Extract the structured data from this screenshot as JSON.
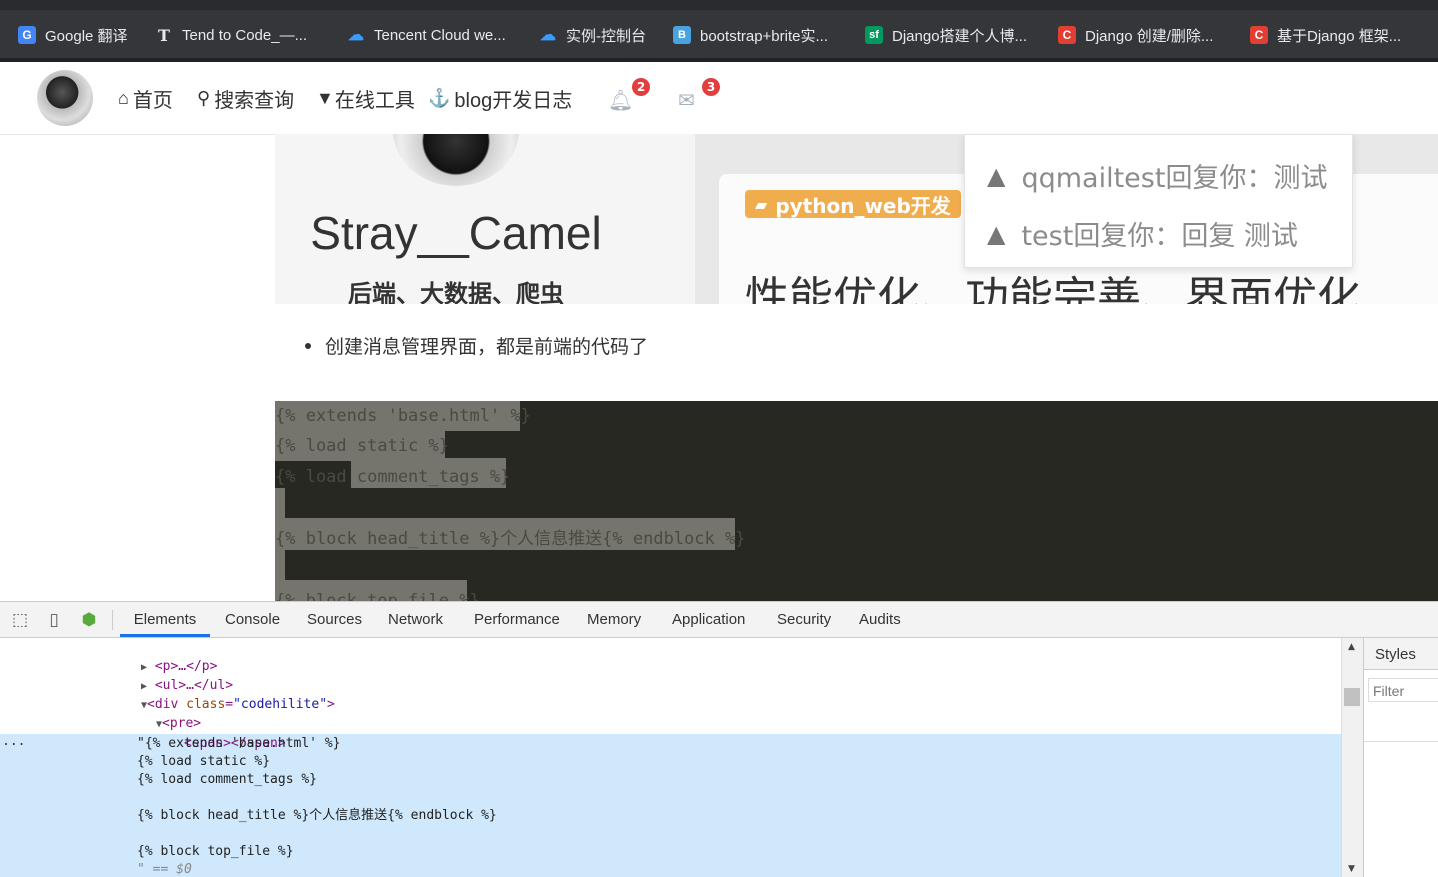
{
  "bookmarks": [
    {
      "label": "Google 翻译",
      "icon": "google-translate-icon"
    },
    {
      "label": "Tend to Code_—...",
      "icon": "t-icon"
    },
    {
      "label": "Tencent Cloud we...",
      "icon": "cloud-icon"
    },
    {
      "label": "实例-控制台",
      "icon": "cloud-icon"
    },
    {
      "label": "bootstrap+brite实...",
      "icon": "bootstrap-icon"
    },
    {
      "label": "Django搭建个人博...",
      "icon": "sf-icon"
    },
    {
      "label": "Django 创建/删除...",
      "icon": "csdn-icon"
    },
    {
      "label": "基于Django 框架...",
      "icon": "csdn-icon"
    }
  ],
  "nav": {
    "home": "首页",
    "search": "搜索查询",
    "tools": "在线工具",
    "devlog": "blog开发日志",
    "bell_count": "2",
    "mail_count": "3"
  },
  "profile": {
    "name": "Stray__Camel",
    "tagline": "后端、大数据、爬虫"
  },
  "banner": {
    "tag": "python_web开发",
    "headline": "性能优化、功能完善、界面优化"
  },
  "notifications": [
    {
      "text": "qqmailtest回复你：测试"
    },
    {
      "text": "test回复你：回复 测试"
    }
  ],
  "article": {
    "bullet": "创建消息管理界面，都是前端的代码了"
  },
  "code_lines": [
    "{% extends 'base.html' %}",
    "{% load static %}",
    "{% load comment_tags %}",
    "",
    "{% block head_title %}个人信息推送{% endblock %}",
    "",
    "{% block top_file %}"
  ],
  "devtools": {
    "tabs": [
      "Elements",
      "Console",
      "Sources",
      "Network",
      "Performance",
      "Memory",
      "Application",
      "Security",
      "Audits"
    ],
    "active_tab": "Elements",
    "styles_tab": "Styles",
    "filter_placeholder": "Filter",
    "dom": {
      "p_collapsed": "<p>…</p>",
      "ul_collapsed": "<ul>…</ul>",
      "div_open": "<div",
      "div_attr": "class",
      "div_attr_value": "\"codehilite\"",
      "div_close": ">",
      "pre_open": "<pre>",
      "span": "<span></span>",
      "text_lines": [
        "\"{% extends 'base.html' %}",
        "{% load static %}",
        "{% load comment_tags %}",
        "",
        "{% block head_title %}个人信息推送{% endblock %}",
        "",
        "{% block top_file %}"
      ],
      "selected_marker": "\" == $0",
      "ellipsis": "..."
    }
  },
  "colors": {
    "accent": "#1a73e8",
    "badge": "#e23e3e",
    "tag_bg": "#f0ad4e",
    "code_bg": "#272822",
    "selection": "#cfe8fc"
  }
}
